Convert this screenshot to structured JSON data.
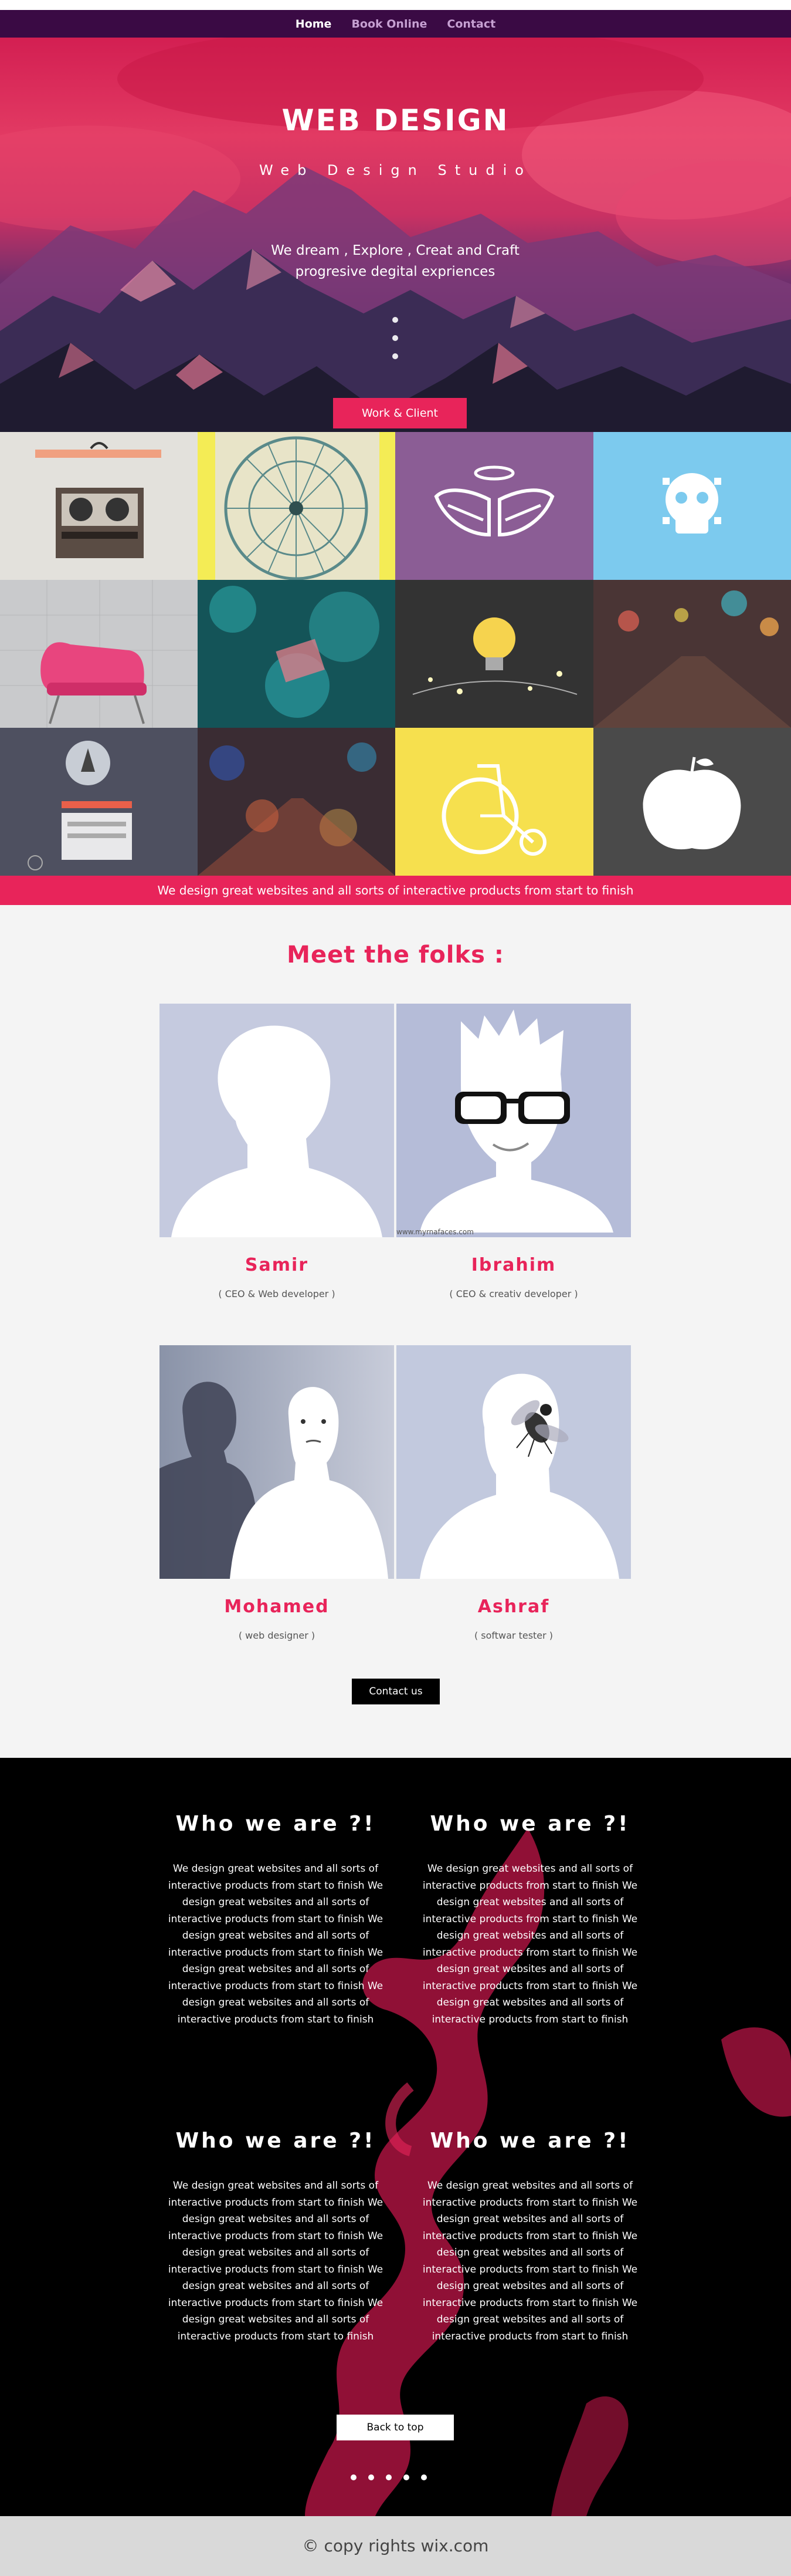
{
  "nav": {
    "items": [
      {
        "label": "Home",
        "active": true
      },
      {
        "label": "Book Online",
        "active": false
      },
      {
        "label": "Contact",
        "active": false
      }
    ]
  },
  "hero": {
    "title": "WEB DESIGN",
    "subtitle": "Web Design Studio",
    "tagline_line1": "We dream , Explore , Creat and Craft",
    "tagline_line2": "progresive degital expriences",
    "button": "Work & Client"
  },
  "gallery": {
    "tiles": [
      "tape-recorder",
      "ferris-wheel",
      "winged-halo-icon",
      "skull-icon",
      "pink-chair",
      "teal-bokeh",
      "light-bulb",
      "city-lights",
      "rocket-mockup",
      "street-bokeh",
      "bicycle-icon",
      "apple-icon"
    ],
    "banner": "We design great websites and all sorts of interactive products from start to finish"
  },
  "team": {
    "title": "Meet the folks :",
    "members": [
      {
        "name": "Samir",
        "role": "( CEO & Web developer )"
      },
      {
        "name": "Ibrahim",
        "role": "( CEO & creativ developer )"
      },
      {
        "name": "Mohamed",
        "role": "( web designer )"
      },
      {
        "name": "Ashraf",
        "role": "( softwar tester )"
      }
    ],
    "watermark": "www.myrnafaces.com",
    "contact_button": "Contact us"
  },
  "about": {
    "blocks": [
      {
        "heading": "Who we are ?!",
        "text": "We design great websites and all sorts of interactive products from start to finish We design great websites and all sorts of interactive products from start to finish We design great websites and all sorts of interactive products from start to finish We design great websites and all sorts of interactive products from start to finish We design great websites and all sorts of interactive products from start to finish"
      },
      {
        "heading": "Who we are ?!",
        "text": "We design great websites and all sorts of interactive products from start to finish We design great websites and all sorts of interactive products from start to finish We design great websites and all sorts of interactive products from start to finish We design great websites and all sorts of interactive products from start to finish We design great websites and all sorts of interactive products from start to finish"
      },
      {
        "heading": "Who we are ?!",
        "text": "We design great websites and all sorts of interactive products from start to finish We design great websites and all sorts of interactive products from start to finish We design great websites and all sorts of interactive products from start to finish We design great websites and all sorts of interactive products from start to finish We design great websites and all sorts of interactive products from start to finish"
      },
      {
        "heading": "Who we are ?!",
        "text": "We design great websites and all sorts of interactive products from start to finish We design great websites and all sorts of interactive products from start to finish We design great websites and all sorts of interactive products from start to finish We design great websites and all sorts of interactive products from start to finish We design great websites and all sorts of interactive products from start to finish"
      }
    ],
    "back_button": "Back to top"
  },
  "footer": {
    "text": "© copy rights wix.com"
  },
  "colors": {
    "accent": "#e8245a",
    "nav_bg": "#3a0a44",
    "nav_active": "#ffffff",
    "nav_inactive": "#c6a0d2",
    "dark": "#000000",
    "light_bg": "#f4f4f4"
  }
}
